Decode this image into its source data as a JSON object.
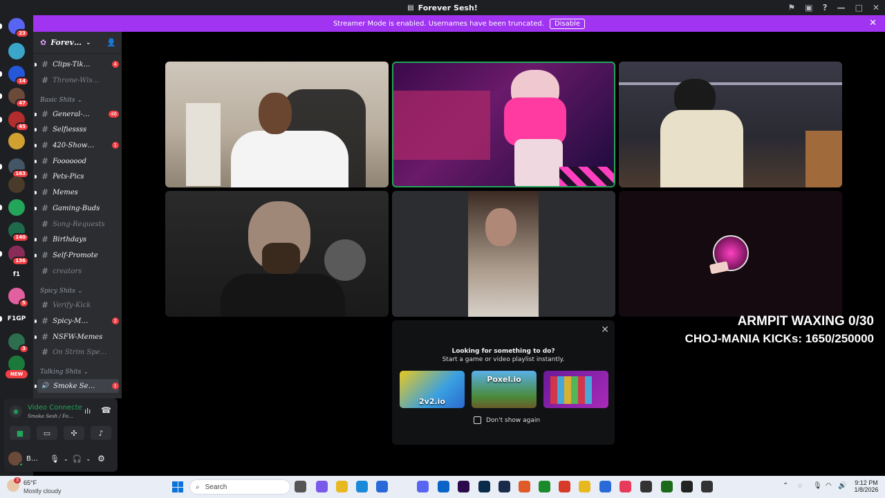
{
  "titlebar": {
    "title": "Forever Sesh!"
  },
  "banner": {
    "text": "Streamer Mode is enabled. Usernames have been truncated.",
    "button": "Disable"
  },
  "guilds": [
    {
      "label": "",
      "badge": "23",
      "color": "#5865f2"
    },
    {
      "label": "",
      "badge": "",
      "color": "#3aa6c9"
    },
    {
      "label": "",
      "badge": "14",
      "color": "#2458d8"
    },
    {
      "label": "",
      "badge": "47",
      "color": "#6b4a3a"
    },
    {
      "label": "",
      "badge": "45",
      "color": "#b22d2d"
    },
    {
      "label": "",
      "badge": "",
      "color": "#d0a030"
    },
    {
      "label": "",
      "badge": "163",
      "color": "#445566"
    },
    {
      "label": "",
      "badge": "",
      "color": "#4a3a2a"
    },
    {
      "label": "",
      "badge": "",
      "color": "#23a55a"
    },
    {
      "label": "",
      "badge": "140",
      "color": "#1e6b4c"
    },
    {
      "label": "",
      "badge": "136",
      "color": "#8a2c5a"
    },
    {
      "label": "f1",
      "badge": "",
      "color": "#1e1f22"
    },
    {
      "label": "",
      "badge": "5",
      "color": "#e060a0"
    },
    {
      "label": "F1GP",
      "badge": "",
      "color": "#1e1f22"
    },
    {
      "label": "",
      "badge": "3",
      "color": "#2d6e4e"
    },
    {
      "label": "",
      "badge": "",
      "color": "#1a7a3a"
    }
  ],
  "new_badge": "NEW",
  "server": {
    "name": "Forev…"
  },
  "channels": [
    {
      "name": "Clips-Tik…",
      "count": "4",
      "muted": false
    },
    {
      "name": "Throne-Wis…",
      "count": "",
      "muted": true
    },
    {
      "name": "General-…",
      "count": "46",
      "muted": false
    },
    {
      "name": "Selfiessss",
      "count": "",
      "muted": false
    },
    {
      "name": "420-Show…",
      "count": "1",
      "muted": false
    },
    {
      "name": "Fooooood",
      "count": "",
      "muted": false
    },
    {
      "name": "Pets-Pics",
      "count": "",
      "muted": false
    },
    {
      "name": "Memes",
      "count": "",
      "muted": false
    },
    {
      "name": "Gaming-Buds",
      "count": "",
      "muted": false
    },
    {
      "name": "Song-Requests",
      "count": "",
      "muted": true
    },
    {
      "name": "Birthdays",
      "count": "",
      "muted": false
    },
    {
      "name": "Self-Promote",
      "count": "",
      "muted": false
    },
    {
      "name": "creators",
      "count": "",
      "muted": true
    },
    {
      "name": "Verify-Kick",
      "count": "",
      "muted": true
    },
    {
      "name": "Spicy-M…",
      "count": "2",
      "muted": false
    },
    {
      "name": "NSFW-Memes",
      "count": "",
      "muted": false
    },
    {
      "name": "On Strim Spe…",
      "count": "",
      "muted": true
    },
    {
      "name": "Smoke Se…",
      "count": "1",
      "muted": false
    }
  ],
  "categories": [
    "Basic Shits",
    "Spicy Shits",
    "Talking Shits"
  ],
  "voice": {
    "status": "Video Connecte",
    "location": "Smoke Sesh / Fo…"
  },
  "user": {
    "name": "B…"
  },
  "overlay": {
    "line1": "ARMPIT WAXING 0/30",
    "line2": "CHOJ-MANIA KICKs: 1650/250000"
  },
  "activity": {
    "title": "Looking for something to do?",
    "subtitle": "Start a game or video playlist instantly.",
    "games": [
      {
        "label": "2v2.io",
        "color": "#3aa0e0"
      },
      {
        "label": "Poxel.io",
        "color": "#4a8a3a"
      },
      {
        "label": "",
        "color": "#8a2aa8"
      }
    ],
    "checkbox": "Don't show again"
  },
  "taskbar": {
    "weather_temp": "65°F",
    "weather_desc": "Mostly cloudy",
    "search": "Search",
    "time": "9:12 PM",
    "date": "1/8/2026",
    "weather_badge": "3"
  }
}
